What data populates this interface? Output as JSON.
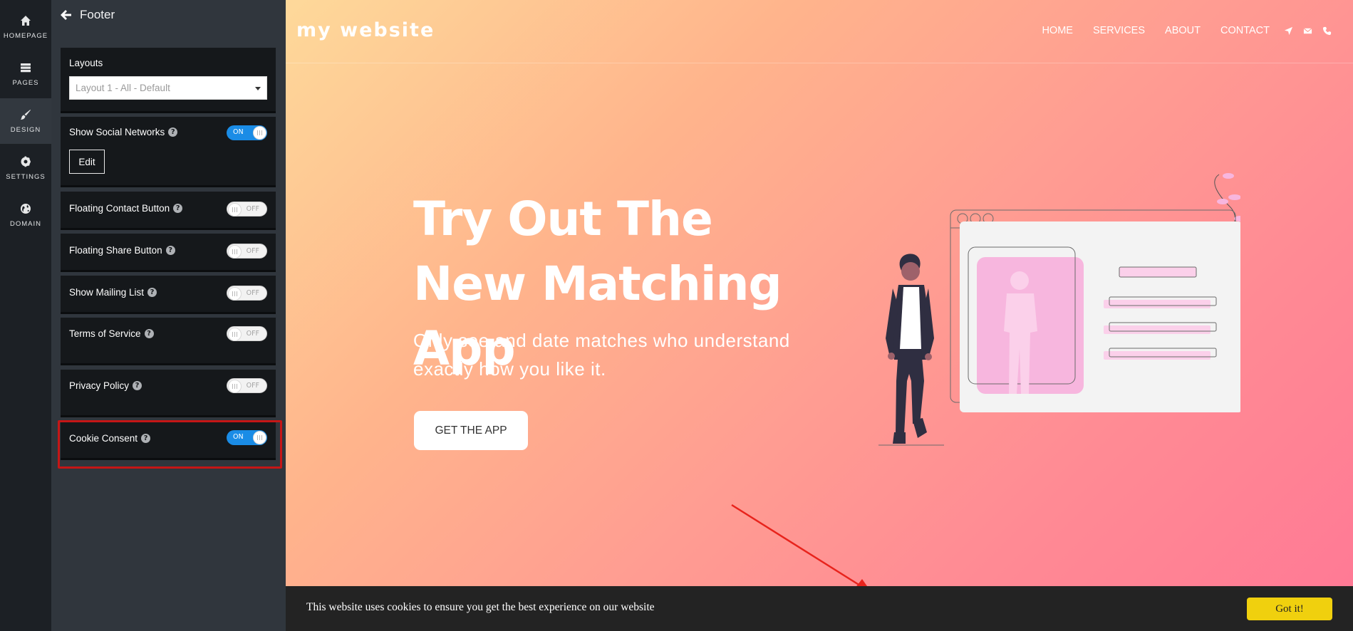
{
  "rail": {
    "items": [
      {
        "label": "HOMEPAGE",
        "icon": "home-icon"
      },
      {
        "label": "PAGES",
        "icon": "pages-icon"
      },
      {
        "label": "DESIGN",
        "icon": "brush-icon",
        "active": true
      },
      {
        "label": "SETTINGS",
        "icon": "gear-icon"
      },
      {
        "label": "DOMAIN",
        "icon": "globe-icon"
      }
    ]
  },
  "panel": {
    "title": "Footer",
    "layouts": {
      "label": "Layouts",
      "selected": "Layout 1 - All - Default"
    },
    "social": {
      "label": "Show Social Networks",
      "toggle": "ON",
      "edit_label": "Edit"
    },
    "floating_contact": {
      "label": "Floating Contact Button",
      "toggle": "OFF"
    },
    "floating_share": {
      "label": "Floating Share Button",
      "toggle": "OFF"
    },
    "mailing_list": {
      "label": "Show Mailing List",
      "toggle": "OFF"
    },
    "terms": {
      "label": "Terms of Service",
      "toggle": "OFF"
    },
    "privacy": {
      "label": "Privacy Policy",
      "toggle": "OFF"
    },
    "cookie": {
      "label": "Cookie Consent",
      "toggle": "ON"
    },
    "help_glyph": "?"
  },
  "site": {
    "brand": "my website",
    "nav": [
      "HOME",
      "SERVICES",
      "ABOUT",
      "CONTACT"
    ],
    "nav_icons": [
      "location-arrow-icon",
      "envelope-icon",
      "phone-icon"
    ],
    "hero_title": "Try Out The New Matching App",
    "hero_subtitle": "Only see and date matches who understand exactly how you like it.",
    "cta_label": "GET THE APP",
    "cookie_text": "This website uses cookies to ensure you get the best experience on our website",
    "cookie_button": "Got it!"
  },
  "colors": {
    "accent_blue": "#1a8ce6",
    "highlight_red": "#c51616",
    "cookie_button": "#f0d00e",
    "gradient_start": "#fed99a",
    "gradient_end": "#ff7895"
  }
}
